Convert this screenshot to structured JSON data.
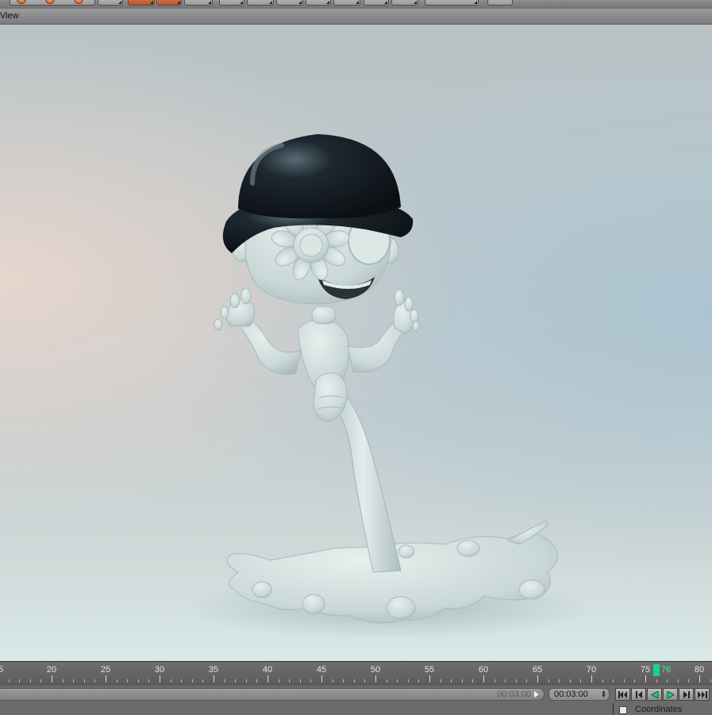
{
  "viewport": {
    "menu_label": "View"
  },
  "timeline": {
    "ticks": [
      "5",
      "20",
      "25",
      "30",
      "35",
      "40",
      "45",
      "50",
      "55",
      "60",
      "65",
      "70",
      "75",
      "80"
    ],
    "current_frame": "76"
  },
  "transport": {
    "range_end": "00:03:00",
    "time_value": "00:03:00",
    "buttons": [
      "go-to-start",
      "step-back",
      "play-reverse",
      "play-forward",
      "step-forward",
      "go-to-end"
    ]
  },
  "attributes": {
    "coordinates_label": "Coordinates"
  },
  "colors": {
    "playhead": "#16d48a",
    "accent_orange": "#c85a2a",
    "hat": "#14191e",
    "figure": "#d3e0df"
  }
}
